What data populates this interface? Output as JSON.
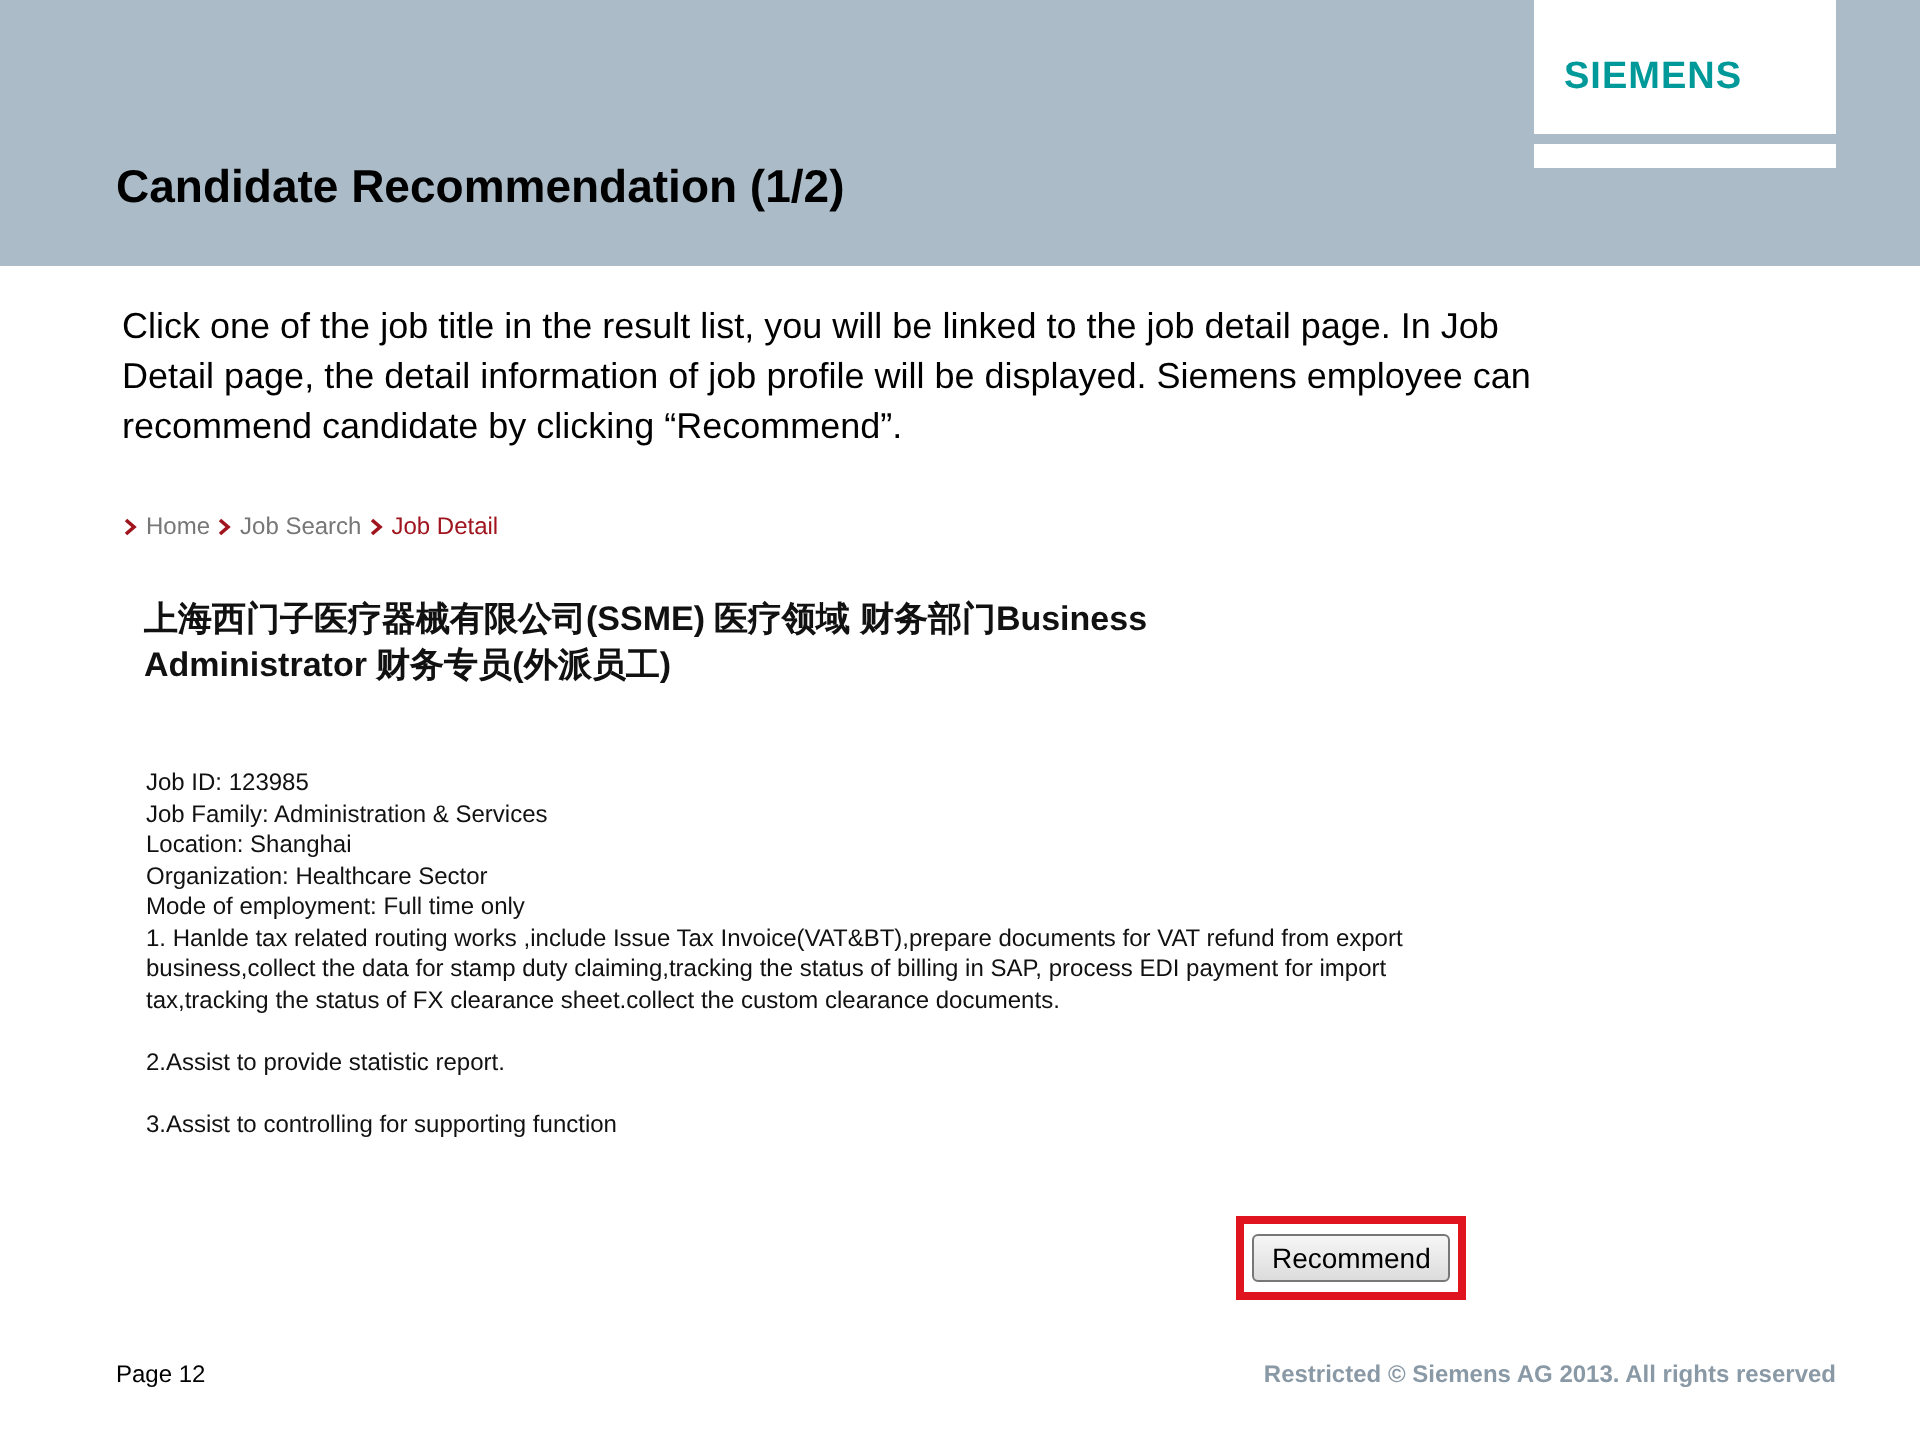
{
  "slide": {
    "title": "Candidate Recommendation (1/2)",
    "logo": "SIEMENS",
    "intro": "Click one of the job title in the result list, you will be linked to the job detail page. In Job Detail page, the detail information of job profile will be displayed. Siemens employee can recommend candidate by clicking “Recommend”.",
    "page_number": "Page 12",
    "footer": "Restricted © Siemens AG 2013. All rights reserved"
  },
  "breadcrumb": [
    {
      "label": "Home",
      "selected": false
    },
    {
      "label": "Job Search",
      "selected": false
    },
    {
      "label": "Job Detail",
      "selected": true
    }
  ],
  "job": {
    "title": "上海西门子医疗器械有限公司(SSME) 医疗领域 财务部门Business Administrator 财务专员(外派员工)",
    "fields": [
      "Job ID: 123985",
      "Job Family: Administration & Services",
      "Location: Shanghai",
      "Organization: Healthcare Sector",
      "Mode of employment: Full time only"
    ],
    "duties": [
      "1. Hanlde tax related  routing works ,include Issue Tax Invoice(VAT&BT),prepare documents for VAT refund from  export business,collect the data for stamp duty claiming,tracking the status of billing in SAP, process EDI payment for import tax,tracking the status of FX clearance sheet.collect the custom clearance documents.",
      "2.Assist to  provide statistic report.",
      "3.Assist to controlling for  supporting function"
    ]
  },
  "recommend_button": {
    "label": "Recommend",
    "highlighted": true
  }
}
